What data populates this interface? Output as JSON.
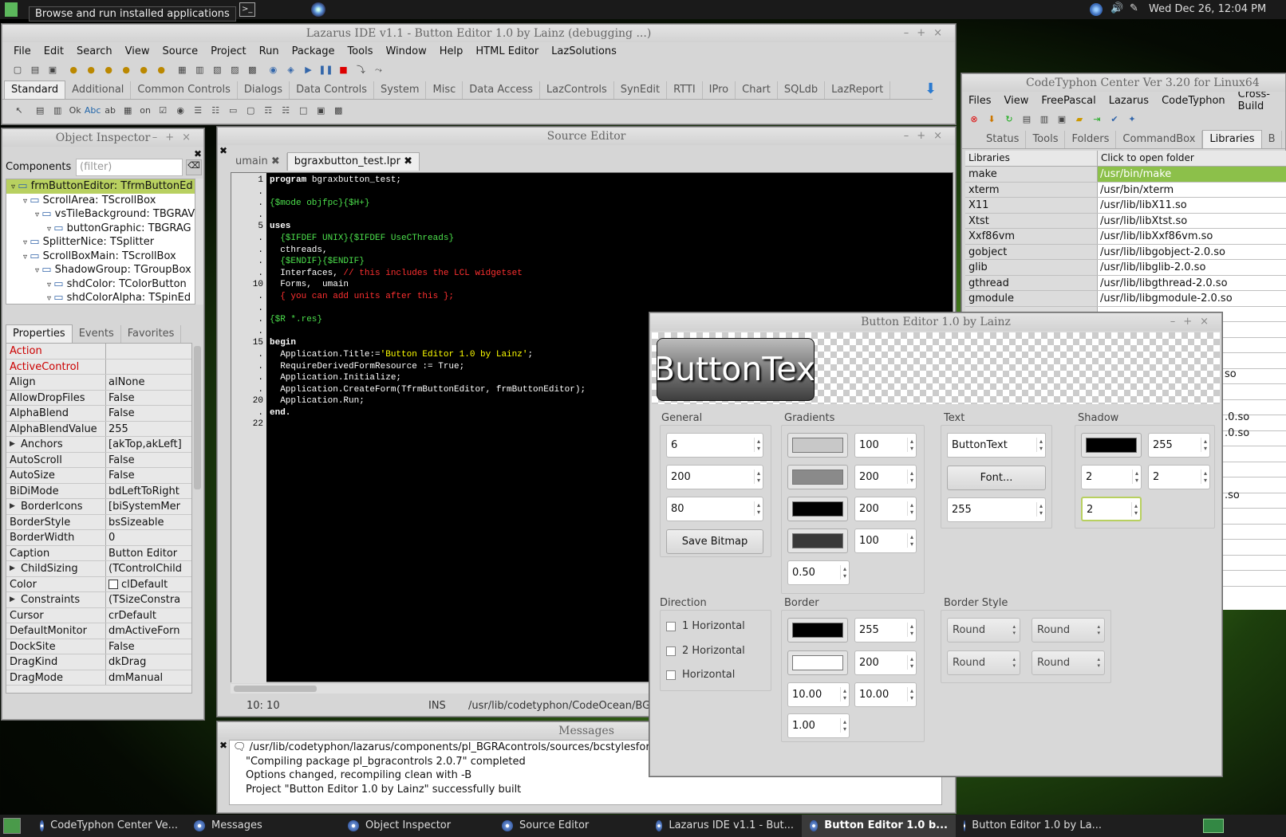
{
  "topbar": {
    "tooltip": "Browse and run installed applications",
    "clock": "Wed Dec 26, 12:04 PM"
  },
  "lazarus": {
    "title": "Lazarus IDE v1.1 - Button Editor 1.0 by Lainz (debugging ...)",
    "menu": [
      "File",
      "Edit",
      "Search",
      "View",
      "Source",
      "Project",
      "Run",
      "Package",
      "Tools",
      "Window",
      "Help",
      "HTML Editor",
      "LazSolutions"
    ],
    "palette_tabs": [
      "Standard",
      "Additional",
      "Common Controls",
      "Dialogs",
      "Data Controls",
      "System",
      "Misc",
      "Data Access",
      "LazControls",
      "SynEdit",
      "RTTI",
      "IPro",
      "Chart",
      "SQLdb",
      "LazReport"
    ]
  },
  "object_inspector": {
    "title": "Object Inspector",
    "components_label": "Components",
    "filter_placeholder": "(filter)",
    "tree": [
      {
        "text": "frmButtonEditor: TfrmButtonEd",
        "level": 0,
        "selected": true
      },
      {
        "text": "ScrollArea: TScrollBox",
        "level": 1
      },
      {
        "text": "vsTileBackground: TBGRAV",
        "level": 2
      },
      {
        "text": "buttonGraphic: TBGRAG",
        "level": 3
      },
      {
        "text": "SplitterNice: TSplitter",
        "level": 1
      },
      {
        "text": "ScrollBoxMain: TScrollBox",
        "level": 1
      },
      {
        "text": "ShadowGroup: TGroupBox",
        "level": 2
      },
      {
        "text": "shdColor: TColorButton",
        "level": 3
      },
      {
        "text": "shdColorAlpha: TSpinEd",
        "level": 3
      }
    ],
    "tabs": [
      "Properties",
      "Events",
      "Favorites"
    ],
    "props": [
      {
        "name": "Action",
        "value": "",
        "red": true
      },
      {
        "name": "ActiveControl",
        "value": "",
        "red": true
      },
      {
        "name": "Align",
        "value": "alNone"
      },
      {
        "name": "AllowDropFiles",
        "value": "False"
      },
      {
        "name": "AlphaBlend",
        "value": "False"
      },
      {
        "name": "AlphaBlendValue",
        "value": "255"
      },
      {
        "name": "Anchors",
        "value": "[akTop,akLeft]",
        "exp": true
      },
      {
        "name": "AutoScroll",
        "value": "False"
      },
      {
        "name": "AutoSize",
        "value": "False"
      },
      {
        "name": "BiDiMode",
        "value": "bdLeftToRight"
      },
      {
        "name": "BorderIcons",
        "value": "[biSystemMer",
        "exp": true
      },
      {
        "name": "BorderStyle",
        "value": "bsSizeable"
      },
      {
        "name": "BorderWidth",
        "value": "0"
      },
      {
        "name": "Caption",
        "value": "Button Editor"
      },
      {
        "name": "ChildSizing",
        "value": "(TControlChild",
        "exp": true
      },
      {
        "name": "Color",
        "value": "clDefault",
        "swatch": true
      },
      {
        "name": "Constraints",
        "value": "(TSizeConstra",
        "exp": true
      },
      {
        "name": "Cursor",
        "value": "crDefault"
      },
      {
        "name": "DefaultMonitor",
        "value": "dmActiveForn"
      },
      {
        "name": "DockSite",
        "value": "False"
      },
      {
        "name": "DragKind",
        "value": "dkDrag"
      },
      {
        "name": "DragMode",
        "value": "dmManual"
      }
    ]
  },
  "source_editor": {
    "title": "Source Editor",
    "tabs": [
      "umain",
      "bgraxbutton_test.lpr"
    ],
    "gutter": [
      "1",
      ".",
      ".",
      ".",
      "5",
      ".",
      ".",
      ".",
      ".",
      "10",
      ".",
      ".",
      ".",
      ".",
      "15",
      ".",
      ".",
      ".",
      ".",
      "20",
      ".",
      "22"
    ],
    "lines": [
      [
        {
          "t": "program ",
          "c": "kw"
        },
        {
          "t": "bgraxbutton_test;",
          "c": "n"
        }
      ],
      [],
      [
        {
          "t": "{$mode objfpc}{$H+}",
          "c": "dir"
        }
      ],
      [],
      [
        {
          "t": "uses",
          "c": "kw"
        }
      ],
      [
        {
          "t": "  {$IFDEF UNIX}{$IFDEF UseCThreads}",
          "c": "dir"
        }
      ],
      [
        {
          "t": "  cthreads,",
          "c": "n"
        }
      ],
      [
        {
          "t": "  {$ENDIF}{$ENDIF}",
          "c": "dir"
        }
      ],
      [
        {
          "t": "  Interfaces, ",
          "c": "n"
        },
        {
          "t": "// this includes the LCL widgetset",
          "c": "cm"
        }
      ],
      [
        {
          "t": "  Forms,  umain",
          "c": "n"
        }
      ],
      [
        {
          "t": "  { you can add units after this };",
          "c": "cm"
        }
      ],
      [],
      [
        {
          "t": "{$R *.res}",
          "c": "dir"
        }
      ],
      [],
      [
        {
          "t": "begin",
          "c": "kw"
        }
      ],
      [
        {
          "t": "  Application.Title:=",
          "c": "n"
        },
        {
          "t": "'Button Editor 1.0 by Lainz'",
          "c": "str"
        },
        {
          "t": ";",
          "c": "n"
        }
      ],
      [
        {
          "t": "  RequireDerivedFormResource := True;",
          "c": "n"
        }
      ],
      [
        {
          "t": "  Application.Initialize;",
          "c": "n"
        }
      ],
      [
        {
          "t": "  Application.CreateForm(TfrmButtonEditor, frmButtonEditor);",
          "c": "n"
        }
      ],
      [
        {
          "t": "  Application.Run;",
          "c": "n"
        }
      ],
      [
        {
          "t": "end.",
          "c": "kw"
        }
      ],
      []
    ],
    "status_pos": "10: 10",
    "status_mode": "INS",
    "status_path": "/usr/lib/codetyphon/CodeOcean/BGR"
  },
  "messages": {
    "title": "Messages",
    "lines": [
      "/usr/lib/codetyphon/lazarus/components/pl_BGRAcontrols/sources/bcstylesform.",
      "\"Compiling package pl_bgracontrols 2.0.7\" completed",
      "Options changed, recompiling clean with -B",
      "Project \"Button Editor 1.0 by Lainz\" successfully built"
    ]
  },
  "codetyphon": {
    "title": "CodeTyphon Center Ver 3.20 for Linux64",
    "menu": [
      "Files",
      "View",
      "FreePascal",
      "Lazarus",
      "CodeTyphon",
      "Cross-Build"
    ],
    "tabs": [
      "Status",
      "Tools",
      "Folders",
      "CommandBox",
      "Libraries",
      "B"
    ],
    "col1": "Libraries",
    "col2": "Click to open folder",
    "libs": [
      {
        "name": "make",
        "path": "/usr/bin/make",
        "hl": true
      },
      {
        "name": "xterm",
        "path": "/usr/bin/xterm"
      },
      {
        "name": "X11",
        "path": "/usr/lib/libX11.so"
      },
      {
        "name": "Xtst",
        "path": "/usr/lib/libXtst.so"
      },
      {
        "name": "Xxf86vm",
        "path": "/usr/lib/libXxf86vm.so"
      },
      {
        "name": "gobject",
        "path": "/usr/lib/libgobject-2.0.so"
      },
      {
        "name": "glib",
        "path": "/usr/lib/libglib-2.0.so"
      },
      {
        "name": "gthread",
        "path": "/usr/lib/libgthread-2.0.so"
      },
      {
        "name": "gmodule",
        "path": "/usr/lib/libgmodule-2.0.so"
      }
    ],
    "tail_paths": [
      "so",
      ".0.so",
      ".0.so",
      ".so"
    ]
  },
  "button_editor": {
    "title": "Button Editor 1.0 by Lainz",
    "preview_text": "ButtonText",
    "general": {
      "label": "General",
      "v1": "6",
      "v2": "200",
      "v3": "80",
      "save": "Save Bitmap"
    },
    "gradients": {
      "label": "Gradients",
      "a1": "100",
      "a2": "200",
      "a3": "200",
      "a4": "100",
      "ratio": "0.50",
      "colors": [
        "#c8c8c8",
        "#8a8a8a",
        "#000000",
        "#383838"
      ]
    },
    "text": {
      "label": "Text",
      "value": "ButtonText",
      "font": "Font...",
      "alpha": "255"
    },
    "shadow": {
      "label": "Shadow",
      "alpha": "255",
      "x": "2",
      "y": "2",
      "blur": "2",
      "color": "#000000"
    },
    "direction": {
      "label": "Direction",
      "opts": [
        "1 Horizontal",
        "2 Horizontal",
        "Horizontal"
      ]
    },
    "border": {
      "label": "Border",
      "a1": "255",
      "a2": "200",
      "r1": "10.00",
      "r2": "10.00",
      "w": "1.00",
      "colors": [
        "#000000",
        "#ffffff"
      ]
    },
    "border_style": {
      "label": "Border Style",
      "vals": [
        "Round",
        "Round",
        "Round",
        "Round"
      ]
    }
  },
  "taskbar": {
    "items": [
      {
        "label": "CodeTyphon Center Ve...",
        "active": false
      },
      {
        "label": "Messages",
        "active": false
      },
      {
        "label": "Object Inspector",
        "active": false
      },
      {
        "label": "Source Editor",
        "active": false
      },
      {
        "label": "Lazarus IDE v1.1 - But...",
        "active": false
      },
      {
        "label": "Button Editor 1.0 b...",
        "active": true
      },
      {
        "label": "Button Editor 1.0 by La...",
        "active": false
      }
    ]
  }
}
